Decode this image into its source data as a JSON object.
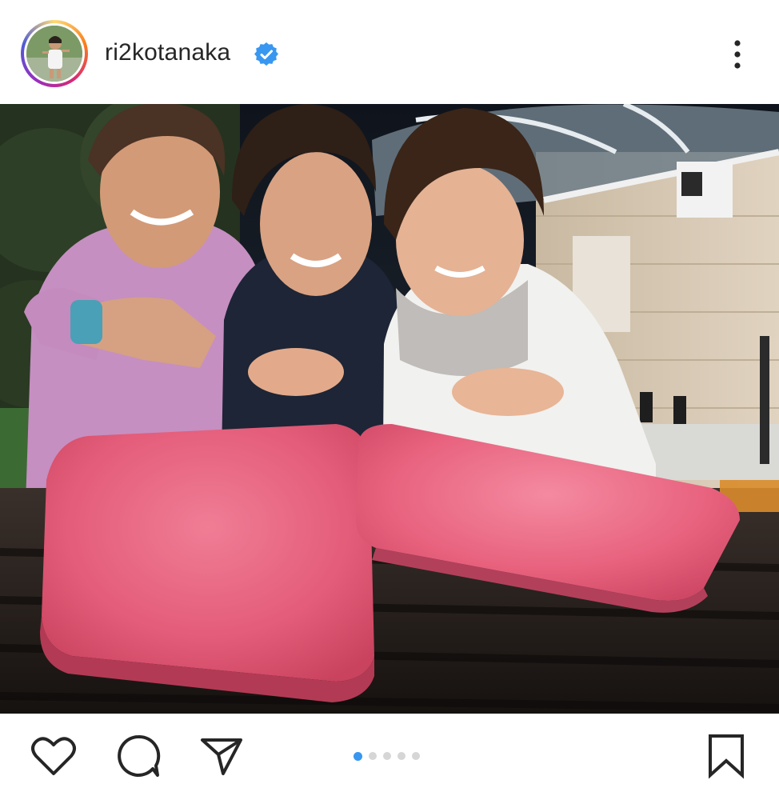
{
  "post": {
    "username": "ri2kotanaka",
    "verified": true,
    "avatar_icon": "profile-avatar",
    "more_icon": "more-vertical-icon",
    "photo_description_icon": "post-photo",
    "carousel": {
      "total": 5,
      "active_index": 0
    },
    "actions": [
      "heart-icon",
      "comment-icon",
      "share-icon",
      "bookmark-icon"
    ]
  },
  "colors": {
    "verified_blue": "#3897f0",
    "active_dot": "#3897f0",
    "inactive_dot": "#d6d6d6",
    "text": "#262626"
  }
}
